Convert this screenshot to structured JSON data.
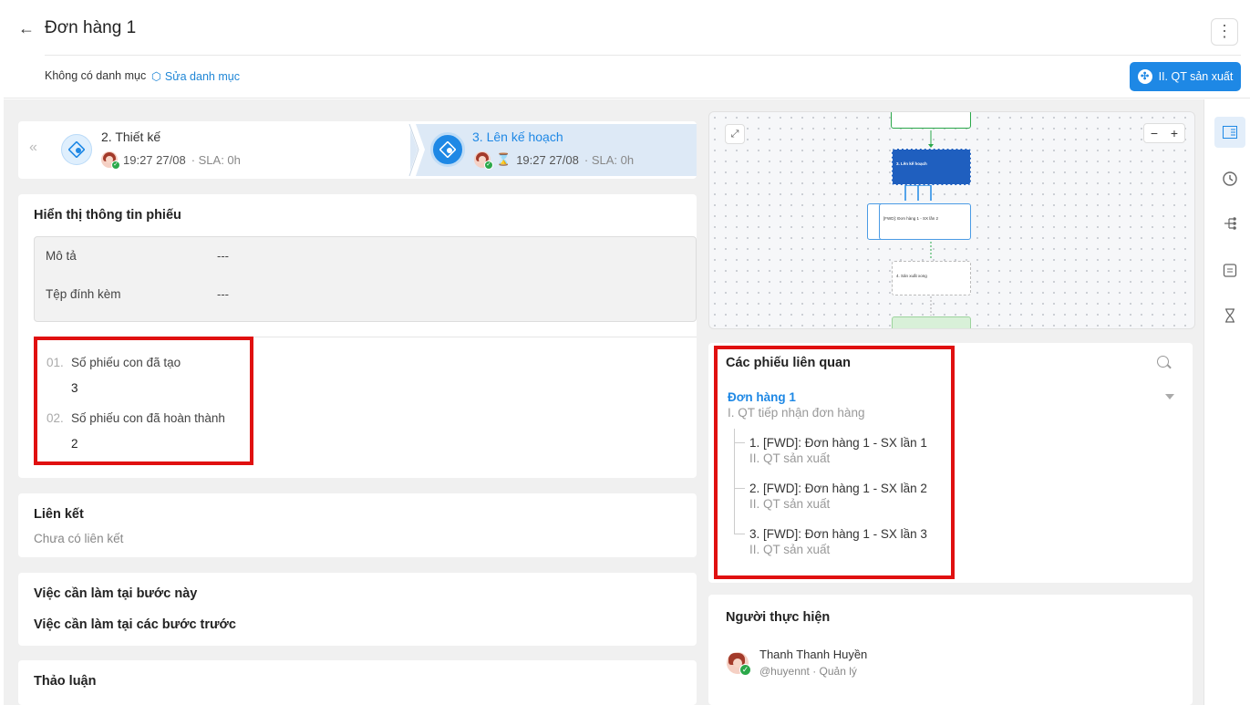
{
  "header": {
    "title": "Đơn hàng 1",
    "no_category": "Không có danh mục",
    "edit_category": "Sửa danh mục",
    "process_button": "II. QT sản xuất"
  },
  "steps": [
    {
      "title": "2. Thiết kế",
      "time": "19:27 27/08",
      "sla": "· SLA: 0h"
    },
    {
      "title": "3. Lên kế hoạch",
      "time": "19:27 27/08",
      "sla": "· SLA: 0h"
    }
  ],
  "info": {
    "section_title": "Hiển thị thông tin phiếu",
    "desc_label": "Mô tả",
    "desc_value": "---",
    "attach_label": "Tệp đính kèm",
    "attach_value": "---",
    "fields": [
      {
        "num": "01.",
        "label": "Số phiếu con đã tạo",
        "value": "3"
      },
      {
        "num": "02.",
        "label": "Số phiếu con đã hoàn thành",
        "value": "2"
      }
    ]
  },
  "links": {
    "title": "Liên kết",
    "empty": "Chưa có liên kết"
  },
  "todo": {
    "current": "Việc cần làm tại bước này",
    "previous": "Việc cần làm tại các bước trước"
  },
  "discussion": {
    "title": "Thảo luận"
  },
  "related": {
    "title": "Các phiếu liên quan",
    "main_title": "Đơn hàng 1",
    "main_sub": "I. QT tiếp nhận đơn hàng",
    "children": [
      {
        "title": "1. [FWD]: Đơn hàng 1 - SX lần 1",
        "sub": "II. QT sản xuất"
      },
      {
        "title": "2. [FWD]: Đơn hàng 1 - SX lần 2",
        "sub": "II. QT sản xuất"
      },
      {
        "title": "3. [FWD]: Đơn hàng 1 - SX lần 3",
        "sub": "II. QT sản xuất"
      }
    ]
  },
  "performer": {
    "title": "Người thực hiện",
    "name": "Thanh Thanh Huyền",
    "handle": "@huyennt · Quản lý"
  },
  "diagram": {
    "zoom_out": "−",
    "zoom_in": "+",
    "node_active": "3. Lên kế hoạch",
    "node_fwd": "[FWD]: Đơn hàng 1 - SX lần 2",
    "node_next": "4. Sản xuất xong"
  },
  "colors": {
    "accent": "#1e88e5",
    "highlight": "#e01010"
  }
}
